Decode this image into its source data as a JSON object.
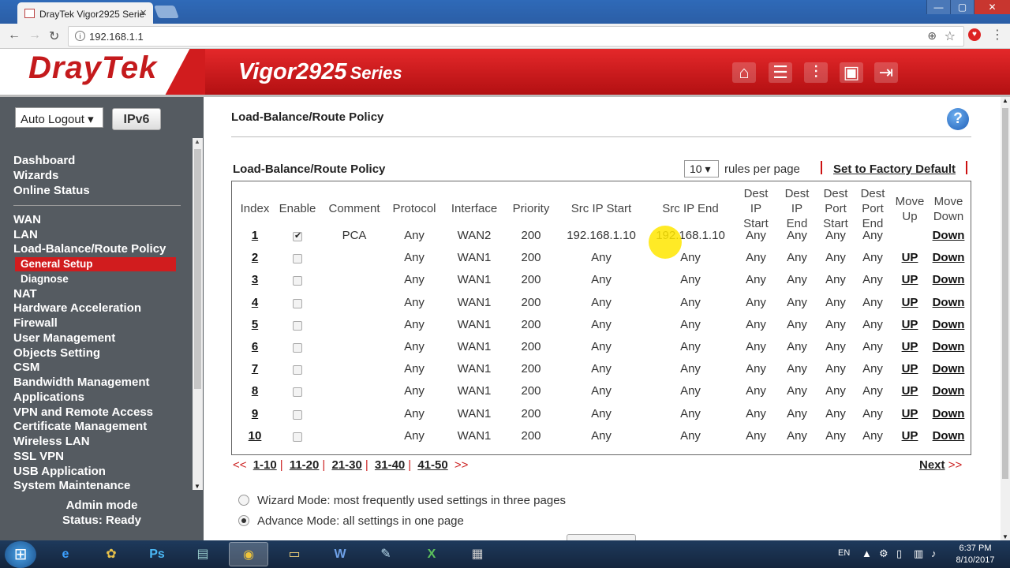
{
  "browser": {
    "tab_title": "DrayTek Vigor2925 Serie",
    "url": "192.168.1.1",
    "window_controls": [
      "—",
      "▢",
      "✕"
    ]
  },
  "header": {
    "logo": "DrayTek",
    "model": "Vigor2925",
    "series": "Series"
  },
  "sidebar": {
    "auto_logout": "Auto Logout",
    "ipv6_label": "IPv6",
    "items": [
      {
        "label": "Dashboard"
      },
      {
        "label": "Wizards"
      },
      {
        "label": "Online Status"
      },
      {
        "label": "WAN"
      },
      {
        "label": "LAN"
      },
      {
        "label": "Load-Balance/Route Policy"
      },
      {
        "label": "General Setup"
      },
      {
        "label": "Diagnose"
      },
      {
        "label": "NAT"
      },
      {
        "label": "Hardware Acceleration"
      },
      {
        "label": "Firewall"
      },
      {
        "label": "User Management"
      },
      {
        "label": "Objects Setting"
      },
      {
        "label": "CSM"
      },
      {
        "label": "Bandwidth Management"
      },
      {
        "label": "Applications"
      },
      {
        "label": "VPN and Remote Access"
      },
      {
        "label": "Certificate Management"
      },
      {
        "label": "Wireless LAN"
      },
      {
        "label": "SSL VPN"
      },
      {
        "label": "USB Application"
      },
      {
        "label": "System Maintenance"
      }
    ],
    "admin_mode": "Admin mode",
    "status": "Status: Ready"
  },
  "main": {
    "page_title": "Load-Balance/Route Policy",
    "subtitle": "Load-Balance/Route Policy",
    "rules_per_page_value": "10",
    "rules_per_page_text": "rules per page",
    "factory_default": "Set to Factory Default",
    "columns": [
      "Index",
      "Enable",
      "Comment",
      "Protocol",
      "Interface",
      "Priority",
      "Src IP Start",
      "Src IP End",
      "Dest IP Start",
      "Dest IP End",
      "Dest Port Start",
      "Dest Port End",
      "Move Up",
      "Move Down"
    ],
    "rows": [
      {
        "index": "1",
        "enabled": true,
        "comment": "PCA",
        "protocol": "Any",
        "interface": "WAN2",
        "priority": "200",
        "src_start": "192.168.1.10",
        "src_end": "192.168.1.10",
        "dst_ip_start": "Any",
        "dst_ip_end": "Any",
        "dst_port_start": "Any",
        "dst_port_end": "Any",
        "up": "",
        "down": "Down"
      },
      {
        "index": "2",
        "enabled": false,
        "comment": "",
        "protocol": "Any",
        "interface": "WAN1",
        "priority": "200",
        "src_start": "Any",
        "src_end": "Any",
        "dst_ip_start": "Any",
        "dst_ip_end": "Any",
        "dst_port_start": "Any",
        "dst_port_end": "Any",
        "up": "UP",
        "down": "Down"
      },
      {
        "index": "3",
        "enabled": false,
        "comment": "",
        "protocol": "Any",
        "interface": "WAN1",
        "priority": "200",
        "src_start": "Any",
        "src_end": "Any",
        "dst_ip_start": "Any",
        "dst_ip_end": "Any",
        "dst_port_start": "Any",
        "dst_port_end": "Any",
        "up": "UP",
        "down": "Down"
      },
      {
        "index": "4",
        "enabled": false,
        "comment": "",
        "protocol": "Any",
        "interface": "WAN1",
        "priority": "200",
        "src_start": "Any",
        "src_end": "Any",
        "dst_ip_start": "Any",
        "dst_ip_end": "Any",
        "dst_port_start": "Any",
        "dst_port_end": "Any",
        "up": "UP",
        "down": "Down"
      },
      {
        "index": "5",
        "enabled": false,
        "comment": "",
        "protocol": "Any",
        "interface": "WAN1",
        "priority": "200",
        "src_start": "Any",
        "src_end": "Any",
        "dst_ip_start": "Any",
        "dst_ip_end": "Any",
        "dst_port_start": "Any",
        "dst_port_end": "Any",
        "up": "UP",
        "down": "Down"
      },
      {
        "index": "6",
        "enabled": false,
        "comment": "",
        "protocol": "Any",
        "interface": "WAN1",
        "priority": "200",
        "src_start": "Any",
        "src_end": "Any",
        "dst_ip_start": "Any",
        "dst_ip_end": "Any",
        "dst_port_start": "Any",
        "dst_port_end": "Any",
        "up": "UP",
        "down": "Down"
      },
      {
        "index": "7",
        "enabled": false,
        "comment": "",
        "protocol": "Any",
        "interface": "WAN1",
        "priority": "200",
        "src_start": "Any",
        "src_end": "Any",
        "dst_ip_start": "Any",
        "dst_ip_end": "Any",
        "dst_port_start": "Any",
        "dst_port_end": "Any",
        "up": "UP",
        "down": "Down"
      },
      {
        "index": "8",
        "enabled": false,
        "comment": "",
        "protocol": "Any",
        "interface": "WAN1",
        "priority": "200",
        "src_start": "Any",
        "src_end": "Any",
        "dst_ip_start": "Any",
        "dst_ip_end": "Any",
        "dst_port_start": "Any",
        "dst_port_end": "Any",
        "up": "UP",
        "down": "Down"
      },
      {
        "index": "9",
        "enabled": false,
        "comment": "",
        "protocol": "Any",
        "interface": "WAN1",
        "priority": "200",
        "src_start": "Any",
        "src_end": "Any",
        "dst_ip_start": "Any",
        "dst_ip_end": "Any",
        "dst_port_start": "Any",
        "dst_port_end": "Any",
        "up": "UP",
        "down": "Down"
      },
      {
        "index": "10",
        "enabled": false,
        "comment": "",
        "protocol": "Any",
        "interface": "WAN1",
        "priority": "200",
        "src_start": "Any",
        "src_end": "Any",
        "dst_ip_start": "Any",
        "dst_ip_end": "Any",
        "dst_port_start": "Any",
        "dst_port_end": "Any",
        "up": "UP",
        "down": "Down"
      }
    ],
    "pager": {
      "prev": "<<",
      "pages": [
        "1-10",
        "11-20",
        "21-30",
        "31-40",
        "41-50"
      ],
      "next_arrows": ">>",
      "next_label": "Next",
      "next_arrows2": ">>"
    },
    "modes": [
      {
        "label": "Wizard Mode: most frequently used settings in three pages",
        "selected": false
      },
      {
        "label": "Advance Mode: all settings in one page",
        "selected": true
      }
    ]
  },
  "taskbar": {
    "language": "EN",
    "time": "6:37 PM",
    "date": "8/10/2017"
  },
  "colors": {
    "brand_red": "#d11c1e",
    "sidebar_bg": "#555b61",
    "active_item": "#d11c1e"
  }
}
